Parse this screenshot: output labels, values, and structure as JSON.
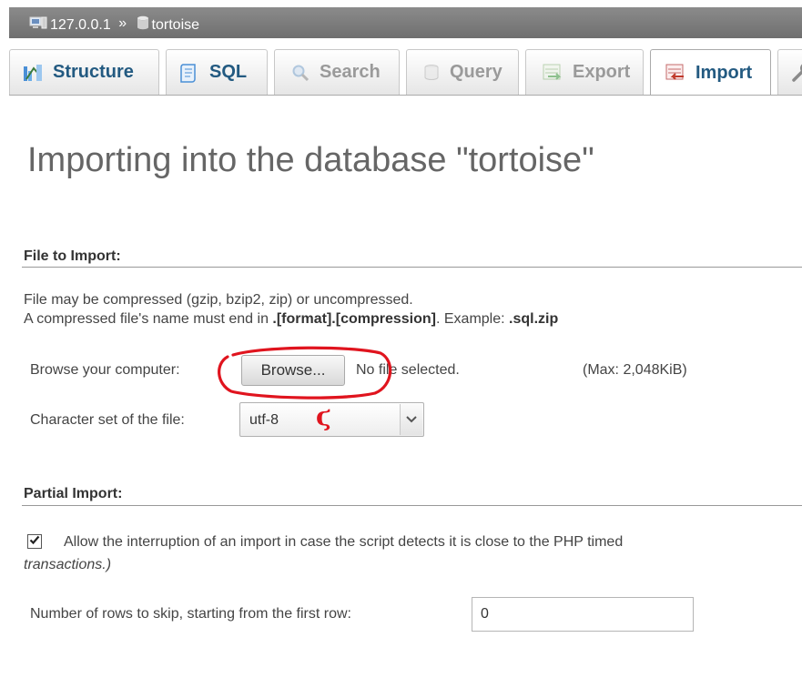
{
  "breadcrumb": {
    "server": "127.0.0.1",
    "separator": "»",
    "database": "tortoise"
  },
  "tabs": [
    {
      "label": "Structure",
      "icon": "structure-icon",
      "state": "normal"
    },
    {
      "label": "SQL",
      "icon": "sql-icon",
      "state": "normal"
    },
    {
      "label": "Search",
      "icon": "search-icon",
      "state": "disabled"
    },
    {
      "label": "Query",
      "icon": "query-icon",
      "state": "disabled"
    },
    {
      "label": "Export",
      "icon": "export-icon",
      "state": "disabled"
    },
    {
      "label": "Import",
      "icon": "import-icon",
      "state": "active"
    },
    {
      "label": "",
      "icon": "wrench-icon",
      "state": "normal"
    }
  ],
  "page_title": "Importing into the database \"tortoise\"",
  "file_section": {
    "title": "File to Import:",
    "line1": "File may be compressed (gzip, bzip2, zip) or uncompressed.",
    "line2_prefix": "A compressed file's name must end in ",
    "line2_format": ".[format].[compression]",
    "line2_middle": ". Example: ",
    "line2_example": ".sql.zip",
    "browse_label": "Browse your computer:",
    "browse_button": "Browse...",
    "no_file": "No file selected.",
    "max_size": "(Max: 2,048KiB)",
    "charset_label": "Character set of the file:",
    "charset_value": "utf-8"
  },
  "partial_section": {
    "title": "Partial Import:",
    "checkbox_checked": true,
    "checkbox_text_line1": "Allow the interruption of an import in case the script detects it is close to the PHP timed",
    "checkbox_text_line2": "transactions.)",
    "skip_label": "Number of rows to skip, starting from the first row:",
    "skip_value": "0"
  },
  "annotation": {
    "color": "#e0141e",
    "mark": "ϛ"
  }
}
